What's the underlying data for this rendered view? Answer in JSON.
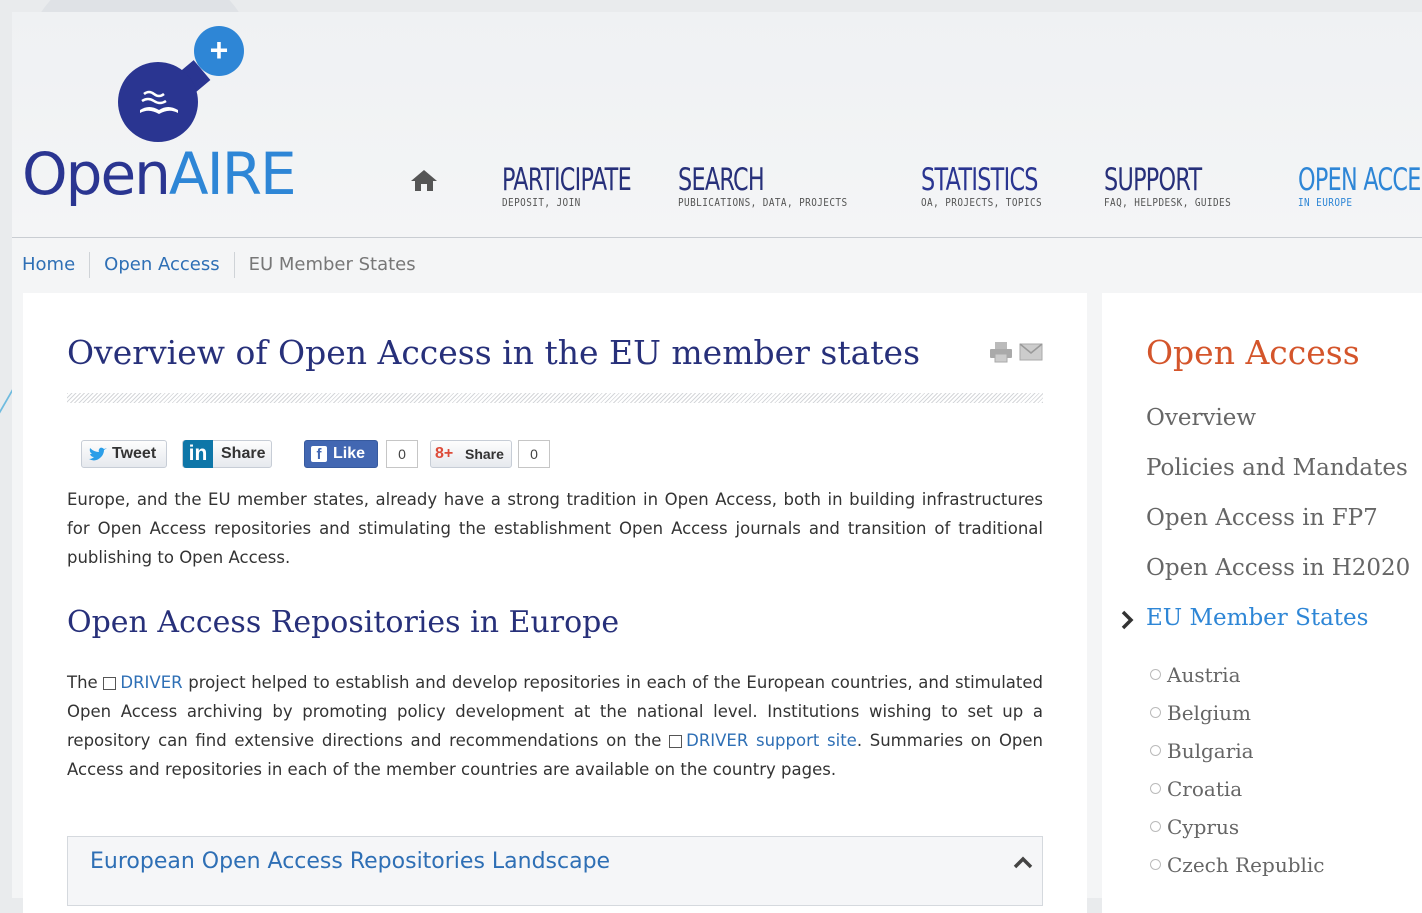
{
  "logo": {
    "part1": "Open",
    "part2": "AIRE"
  },
  "nav": [
    {
      "title": "PARTICIPATE",
      "sub": "DEPOSIT, JOIN"
    },
    {
      "title": "SEARCH",
      "sub": "PUBLICATIONS, DATA, PROJECTS"
    },
    {
      "title": "STATISTICS",
      "sub": "OA, PROJECTS, TOPICS"
    },
    {
      "title": "SUPPORT",
      "sub": "FAQ, HELPDESK, GUIDES"
    },
    {
      "title": "OPEN ACCESS",
      "sub": "IN EUROPE"
    }
  ],
  "breadcrumb": [
    "Home",
    "Open Access",
    "EU Member States"
  ],
  "main": {
    "title": "Overview of Open Access in the EU member states",
    "share": {
      "tweet": "Tweet",
      "linkedin": "Share",
      "fb_like": "Like",
      "fb_count": "0",
      "gplus": "Share",
      "gplus_count": "0"
    },
    "para1": "Europe, and the EU member states, already have a strong tradition in Open Access, both in building infrastructures for Open Access repositories and stimulating the establishment Open Access journals and transition of traditional publishing to Open Access.",
    "h2": "Open Access Repositories in Europe",
    "para2": {
      "t1": "The ",
      "link1": "DRIVER",
      "t2": " project helped to establish and develop repositories in each of the European countries, and stimulated Open Access archiving by promoting policy development at the national level. Institutions wishing to set up a repository can find extensive directions and recommendations on the ",
      "link2": "DRIVER support site",
      "t3": ". Summaries on Open Access and repositories in each of the member countries are available on the country pages."
    },
    "accordion_title": "European Open Access Repositories Landscape"
  },
  "sidebar": {
    "title": "Open Access",
    "items": [
      "Overview",
      "Policies and Mandates",
      "Open Access in FP7",
      "Open Access in H2020",
      "EU Member States"
    ],
    "countries": [
      "Austria",
      "Belgium",
      "Bulgaria",
      "Croatia",
      "Cyprus",
      "Czech Republic"
    ]
  }
}
